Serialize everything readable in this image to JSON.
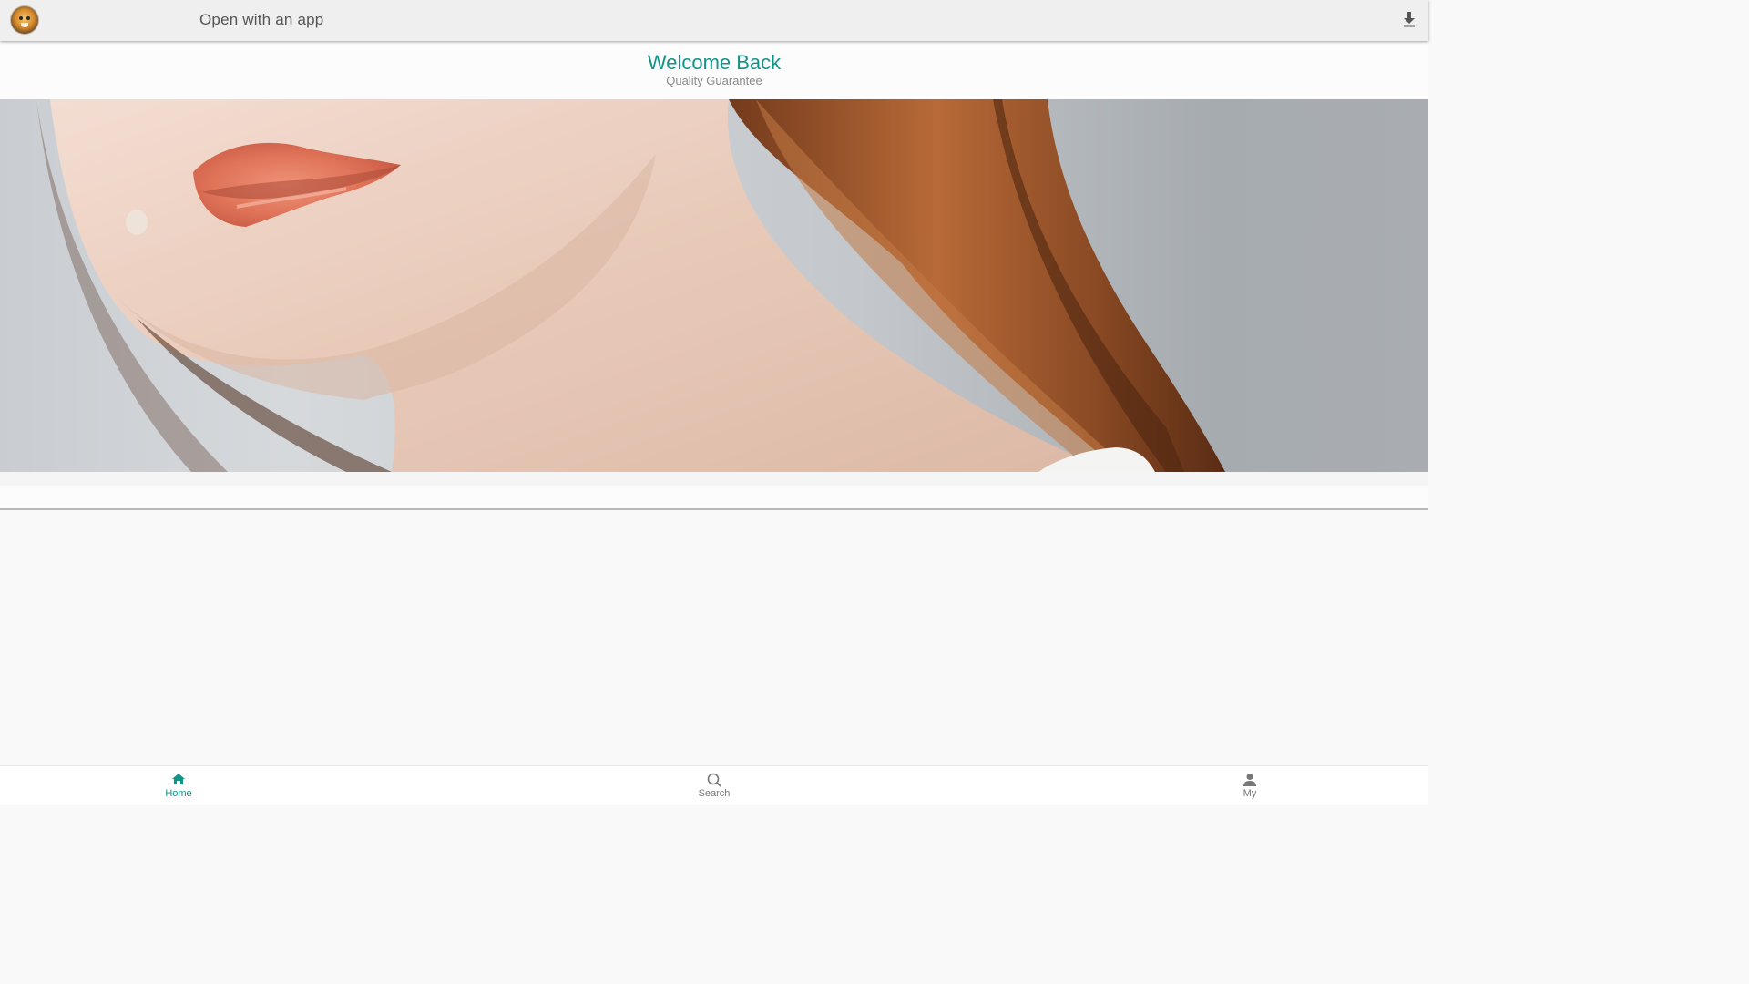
{
  "app_bar": {
    "logo": "tiger-logo",
    "open_label": "Open with an app",
    "download_icon": "download-icon"
  },
  "header": {
    "title": "Welcome Back",
    "subtitle": "Quality Guarantee"
  },
  "banner": {
    "image": "woman-lips-portrait-banner"
  },
  "bottom_nav": {
    "items": [
      {
        "label": "Home",
        "icon": "home-icon",
        "active": true
      },
      {
        "label": "Search",
        "icon": "search-icon",
        "active": false
      },
      {
        "label": "My",
        "icon": "user-icon",
        "active": false
      }
    ]
  },
  "colors": {
    "accent": "#119488",
    "inactive": "#777777"
  }
}
